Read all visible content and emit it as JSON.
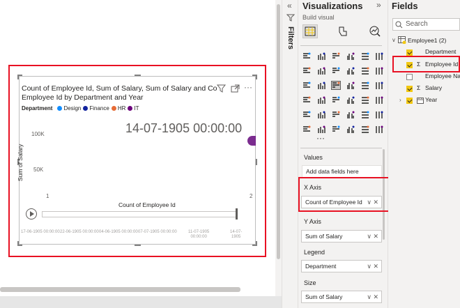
{
  "chart": {
    "title": "Count of Employee Id, Sum of Salary, Sum of Salary and Co",
    "title_cont": "Employee Id by Department and Year",
    "legend_title": "Department",
    "legend_items": [
      {
        "label": "Design",
        "color": "#118dff"
      },
      {
        "label": "Finance",
        "color": "#12239e"
      },
      {
        "label": "HR",
        "color": "#e66c37"
      },
      {
        "label": "IT",
        "color": "#6b007b"
      }
    ],
    "play_date": "14-07-1905 00:00:00",
    "ylabel": "Sum of Salary",
    "xlabel": "Count of Employee Id",
    "yticks": [
      "100K",
      "50K"
    ],
    "xticks": [
      "1",
      "2"
    ],
    "play_ticks": [
      {
        "d": "17-06-1905 00:00:00",
        "t": ""
      },
      {
        "d": "22-06-1905 00:00:00",
        "t": ""
      },
      {
        "d": "04-06-1905 00:00:00",
        "t": ""
      },
      {
        "d": "07-07-1905 00:00:00",
        "t": ""
      },
      {
        "d": "11-07-1905",
        "t": "00:00:00"
      },
      {
        "d": "14-07-",
        "t": "1905"
      }
    ],
    "point_color": "#7b2c8f"
  },
  "filters_label": "Filters",
  "viz": {
    "title": "Visualizations",
    "build_visual": "Build visual",
    "values_label": "Values",
    "values_placeholder": "Add data fields here",
    "x_axis_label": "X Axis",
    "x_axis_field": "Count of Employee Id",
    "y_axis_label": "Y Axis",
    "y_axis_field": "Sum of Salary",
    "legend_label": "Legend",
    "legend_field": "Department",
    "size_label": "Size",
    "size_field": "Sum of Salary",
    "more": "···"
  },
  "fields": {
    "title": "Fields",
    "search_placeholder": "Search",
    "table_name": "Employee1 (2)",
    "items": [
      {
        "label": "Department",
        "checked": true,
        "sigma": false
      },
      {
        "label": "Employee Id",
        "checked": true,
        "sigma": true
      },
      {
        "label": "Employee Na",
        "checked": false,
        "sigma": false
      },
      {
        "label": "Salary",
        "checked": true,
        "sigma": true
      },
      {
        "label": "Year",
        "checked": true,
        "sigma": false
      }
    ]
  },
  "colors": {
    "accent": "#f2c811",
    "selection": "#e81123"
  }
}
